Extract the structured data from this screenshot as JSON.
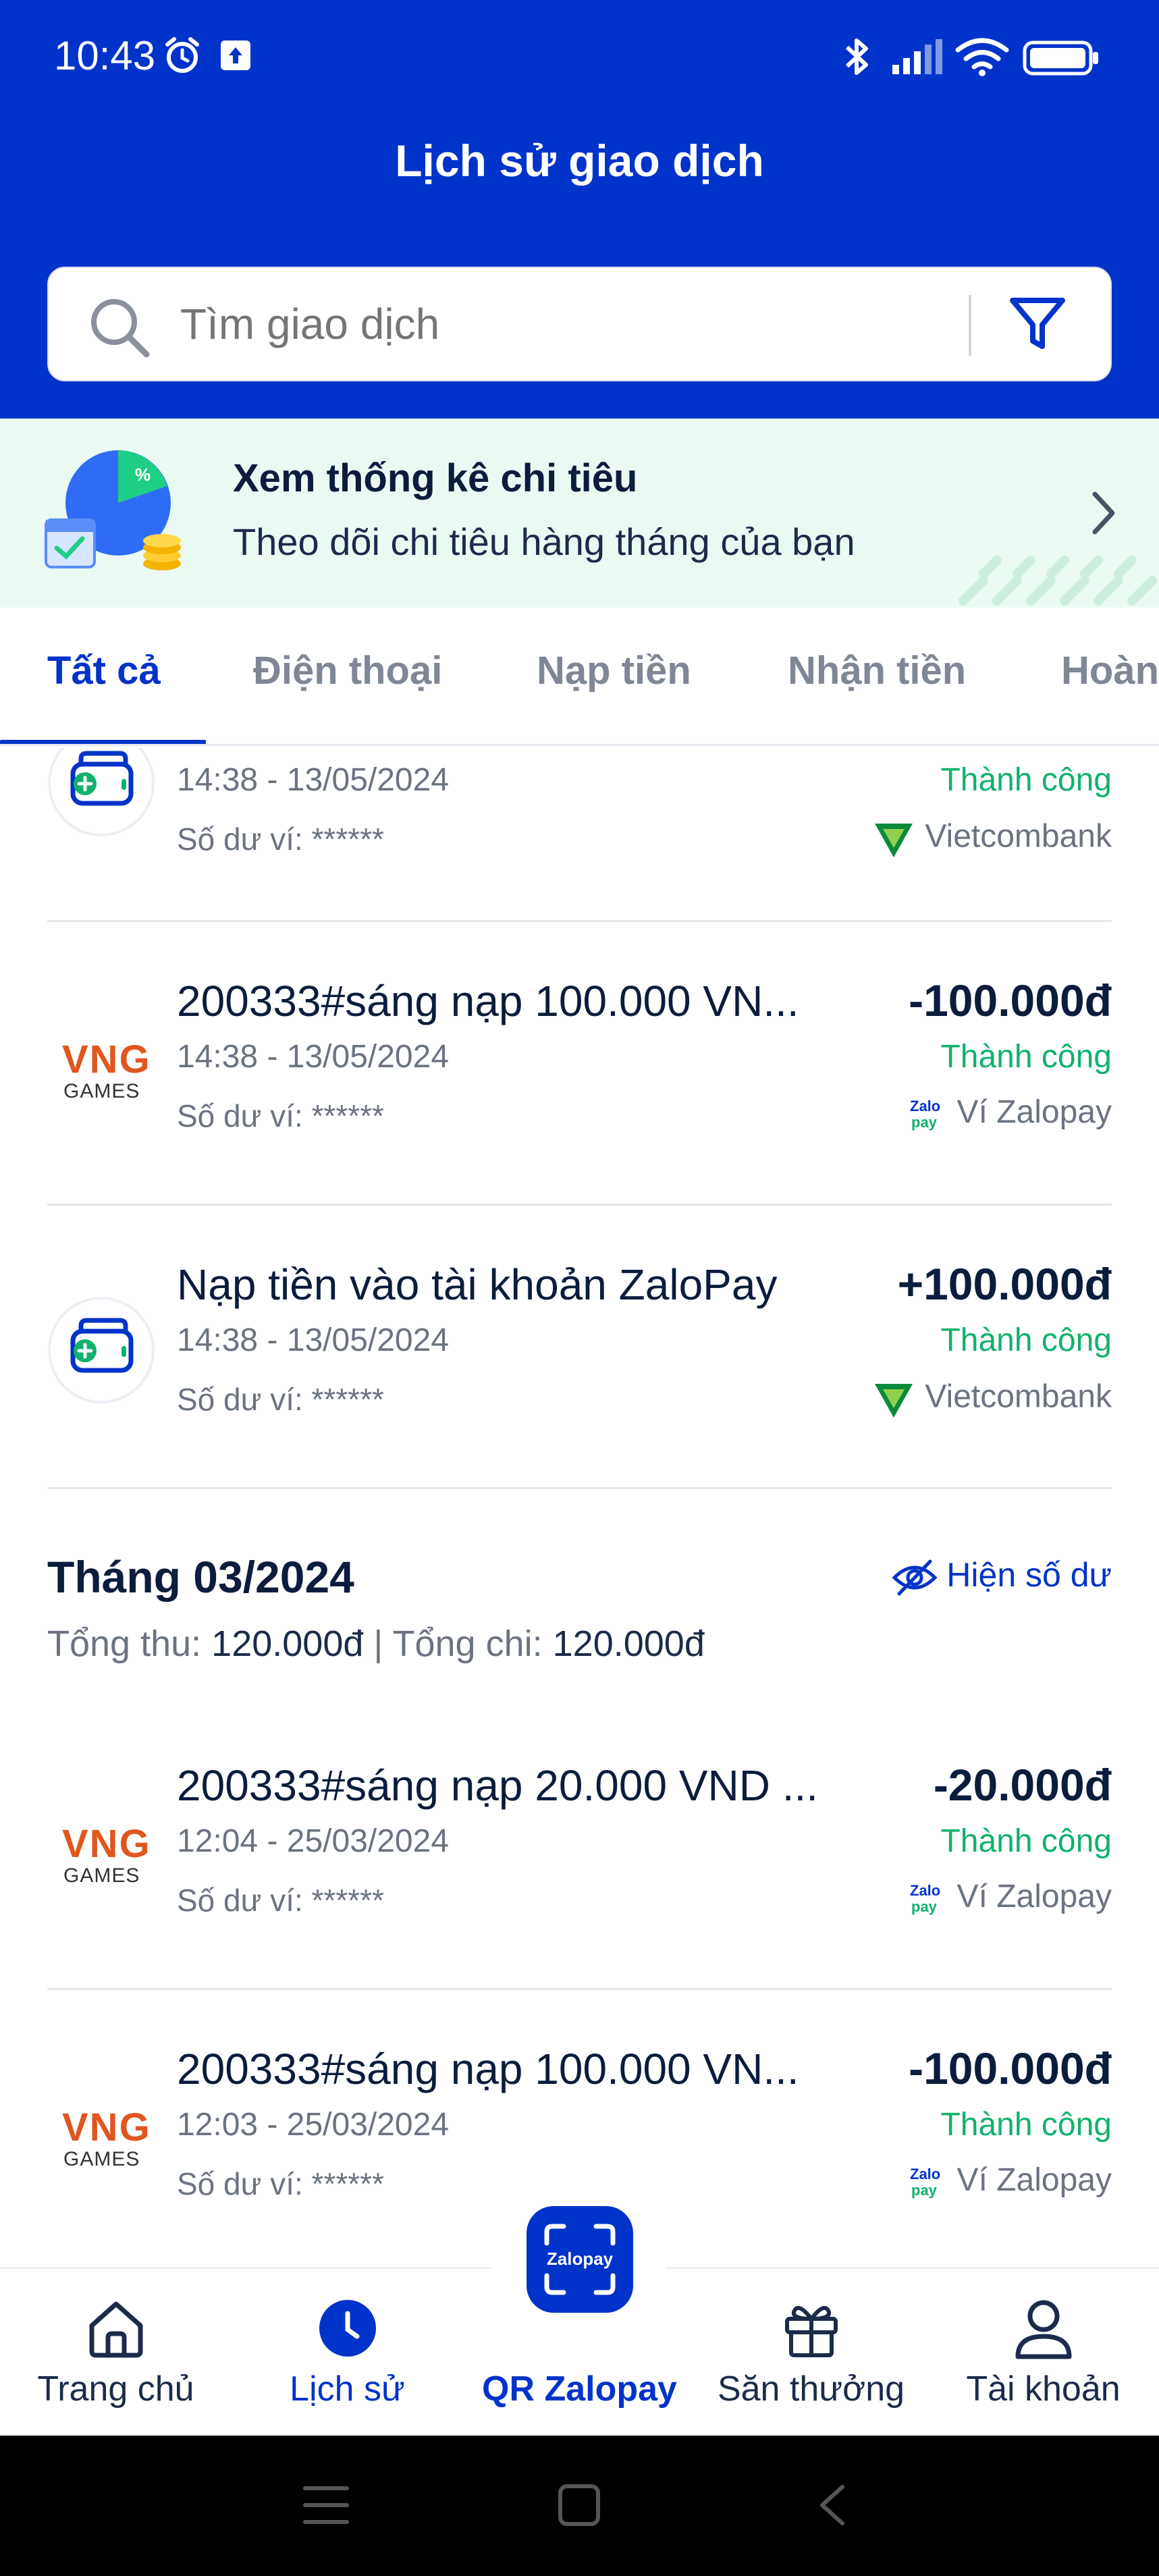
{
  "status_bar": {
    "time": "10:43"
  },
  "header": {
    "title": "Lịch sử giao dịch",
    "search_placeholder": "Tìm giao dịch"
  },
  "banner": {
    "title": "Xem thống kê chi tiêu",
    "subtitle": "Theo dõi chi tiêu hàng tháng của bạn",
    "chart_badge": "%"
  },
  "tabs": [
    "Tất cả",
    "Điện thoại",
    "Nạp tiền",
    "Nhận tiền",
    "Hoàn"
  ],
  "transactions_top": [
    {
      "logo": "wallet-topup",
      "title": "",
      "amount": "",
      "time": "14:38 - 13/05/2024",
      "status": "Thành công",
      "balance": "Số dư ví: ******",
      "source": "Vietcombank",
      "source_icon": "vietcombank"
    },
    {
      "logo": "vng-games",
      "title": "200333#sáng nạp 100.000 VN...",
      "amount": "-100.000đ",
      "time": "14:38 - 13/05/2024",
      "status": "Thành công",
      "balance": "Số dư ví: ******",
      "source": "Ví Zalopay",
      "source_icon": "zalopay"
    },
    {
      "logo": "wallet-topup",
      "title": "Nạp tiền vào tài khoản ZaloPay",
      "amount": "+100.000đ",
      "time": "14:38 - 13/05/2024",
      "status": "Thành công",
      "balance": "Số dư ví: ******",
      "source": "Vietcombank",
      "source_icon": "vietcombank"
    }
  ],
  "month_section": {
    "title": "Tháng 03/2024",
    "toggle_label": "Hiện số dư",
    "income_label": "Tổng thu:",
    "income_value": "120.000đ",
    "separator": "|",
    "expense_label": "Tổng chi:",
    "expense_value": "120.000đ"
  },
  "transactions_march": [
    {
      "logo": "vng-games",
      "title": "200333#sáng nạp 20.000 VND ...",
      "amount": "-20.000đ",
      "time": "12:04 - 25/03/2024",
      "status": "Thành công",
      "balance": "Số dư ví: ******",
      "source": "Ví Zalopay",
      "source_icon": "zalopay"
    },
    {
      "logo": "vng-games",
      "title": "200333#sáng nạp 100.000 VN...",
      "amount": "-100.000đ",
      "time": "12:03 - 25/03/2024",
      "status": "Thành công",
      "balance": "Số dư ví: ******",
      "source": "Ví Zalopay",
      "source_icon": "zalopay"
    }
  ],
  "logos": {
    "vng_top": "VNG",
    "vng_bottom": "GAMES",
    "zalo_top": "Zalo",
    "zalo_bottom": "pay",
    "qr_brand": "Zalopay"
  },
  "bottom_nav": {
    "home": "Trang chủ",
    "history": "Lịch sử",
    "qr": "QR Zalopay",
    "rewards": "Săn thưởng",
    "account": "Tài khoản"
  },
  "colors": {
    "primary": "#0033c9",
    "success": "#10b26a",
    "banner_bg": "#eafaf3",
    "vng": "#e0561f"
  }
}
